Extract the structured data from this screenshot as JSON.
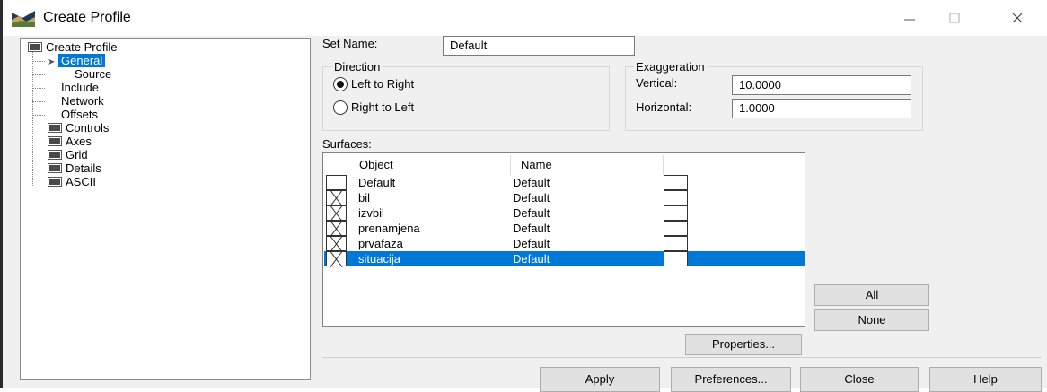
{
  "window": {
    "title": "Create Profile"
  },
  "tree": {
    "root": "Create Profile",
    "children": [
      "General",
      "Source",
      "Include",
      "Network",
      "Offsets"
    ],
    "folders": [
      "Controls",
      "Axes",
      "Grid",
      "Details",
      "ASCII"
    ],
    "selected": "General"
  },
  "set_name": {
    "label": "Set Name:",
    "value": "Default"
  },
  "direction": {
    "title": "Direction",
    "options": [
      "Left to Right",
      "Right to Left"
    ],
    "selected": "Left to Right"
  },
  "exaggeration": {
    "title": "Exaggeration",
    "vertical_label": "Vertical:",
    "vertical_value": "10.0000",
    "horizontal_label": "Horizontal:",
    "horizontal_value": "1.0000"
  },
  "surfaces": {
    "label": "Surfaces:",
    "columns": [
      "Object",
      "Name"
    ],
    "rows": [
      {
        "object": "Default",
        "name": "Default",
        "checked": false,
        "selected": false
      },
      {
        "object": "bil",
        "name": "Default",
        "checked": true,
        "selected": false
      },
      {
        "object": "izvbil",
        "name": "Default",
        "checked": true,
        "selected": false
      },
      {
        "object": "prenamjena",
        "name": "Default",
        "checked": true,
        "selected": false
      },
      {
        "object": "prvafaza",
        "name": "Default",
        "checked": true,
        "selected": false
      },
      {
        "object": "situacija",
        "name": "Default",
        "checked": true,
        "selected": true
      }
    ]
  },
  "buttons": {
    "all": "All",
    "none": "None",
    "properties": "Properties...",
    "apply": "Apply",
    "preferences": "Preferences...",
    "close": "Close",
    "help": "Help"
  },
  "colors": {
    "selection": "#0078d7",
    "dialog_bg": "#f0f0f0"
  }
}
